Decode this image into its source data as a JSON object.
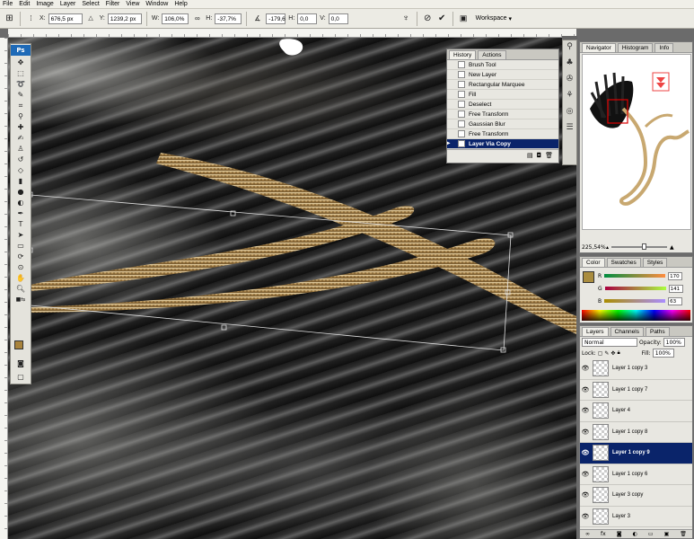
{
  "menu": [
    "File",
    "Edit",
    "Image",
    "Layer",
    "Select",
    "Filter",
    "View",
    "Window",
    "Help"
  ],
  "options": {
    "x_label": "X:",
    "x_value": "676,5 px",
    "y_label": "Y:",
    "y_value": "1239,2 px",
    "w_label": "W:",
    "w_value": "106,0%",
    "h_label": "H:",
    "h_value": "-37,7%",
    "angle_value": "-179,6",
    "hskew_label": "H:",
    "hskew_value": "0,0",
    "vskew_label": "V:",
    "vskew_value": "0,0",
    "workspace_label": "Workspace"
  },
  "tools": {
    "logo": "Ps",
    "fg_color": "#a8833c"
  },
  "history": {
    "tabs": [
      "History",
      "Actions"
    ],
    "items": [
      {
        "label": "Brush Tool",
        "selected": false
      },
      {
        "label": "New Layer",
        "selected": false
      },
      {
        "label": "Rectangular Marquee",
        "selected": false
      },
      {
        "label": "Fill",
        "selected": false
      },
      {
        "label": "Deselect",
        "selected": false
      },
      {
        "label": "Free Transform",
        "selected": false
      },
      {
        "label": "Gaussian Blur",
        "selected": false
      },
      {
        "label": "Free Transform",
        "selected": false
      },
      {
        "label": "Layer Via Copy",
        "selected": true
      }
    ]
  },
  "navigator": {
    "tabs": [
      "Navigator",
      "Histogram",
      "Info"
    ],
    "zoom": "225,54%"
  },
  "color": {
    "tabs": [
      "Color",
      "Swatches",
      "Styles"
    ],
    "r_label": "R",
    "r_value": "170",
    "g_label": "G",
    "g_value": "141",
    "b_label": "B",
    "b_value": "63",
    "swatch": "#aa8d3f"
  },
  "layers": {
    "tabs": [
      "Layers",
      "Channels",
      "Paths"
    ],
    "blend_mode": "Normal",
    "opacity_label": "Opacity:",
    "opacity_value": "100%",
    "lock_label": "Lock:",
    "fill_label": "Fill:",
    "fill_value": "100%",
    "items": [
      {
        "label": "Layer 1 copy 3",
        "selected": false
      },
      {
        "label": "Layer 1 copy 7",
        "selected": false
      },
      {
        "label": "Layer 4",
        "selected": false
      },
      {
        "label": "Layer 1 copy 8",
        "selected": false
      },
      {
        "label": "Layer 1 copy 9",
        "selected": true
      },
      {
        "label": "Layer 1 copy 6",
        "selected": false
      },
      {
        "label": "Layer 3 copy",
        "selected": false
      },
      {
        "label": "Layer 3",
        "selected": false
      }
    ]
  }
}
